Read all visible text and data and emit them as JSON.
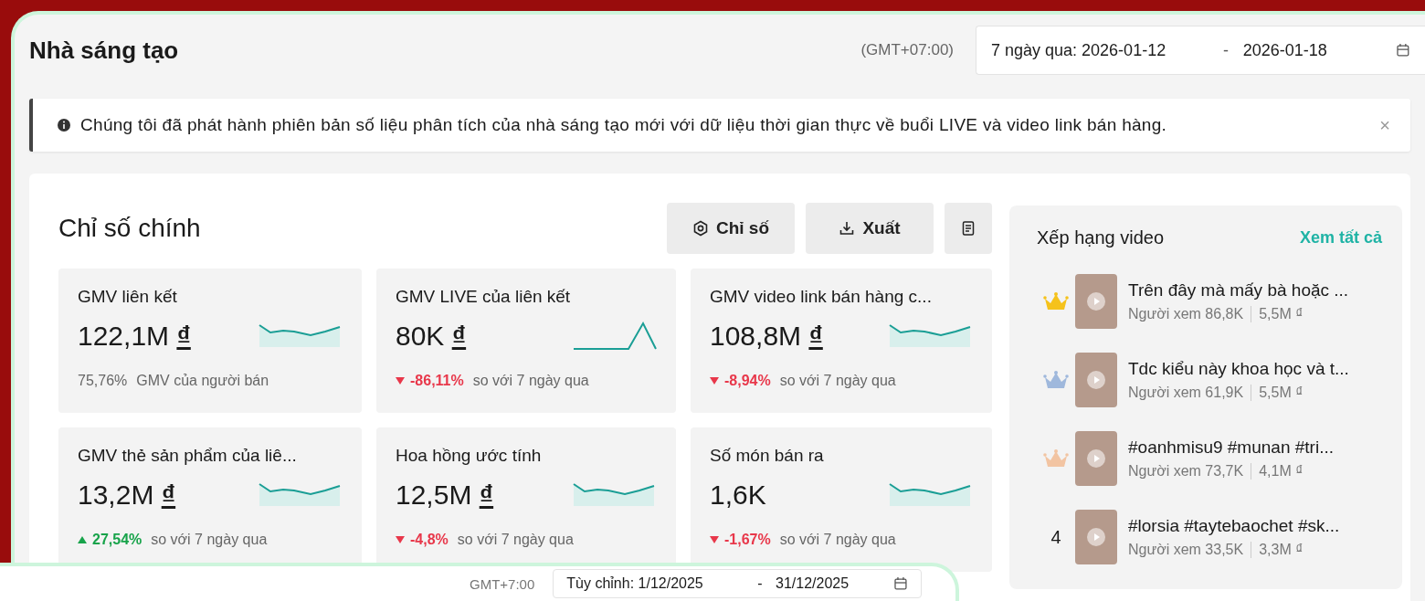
{
  "header": {
    "title": "Nhà sáng tạo",
    "timezone": "(GMT+07:00)",
    "date_range": {
      "start": "7 ngày qua: 2026-01-12",
      "separator": "-",
      "end": "2026-01-18"
    }
  },
  "notice": {
    "text": "Chúng tôi đã phát hành phiên bản số liệu phân tích của nhà sáng tạo mới với dữ liệu thời gian thực về buổi LIVE và video link bán hàng.",
    "close": "×"
  },
  "metrics": {
    "title": "Chỉ số chính",
    "buttons": [
      {
        "label": "Chỉ số",
        "kind": "settings"
      },
      {
        "label": "Xuất",
        "kind": "download"
      },
      {
        "kind": "report"
      }
    ],
    "cards": [
      {
        "kind": "wave",
        "label": "GMV liên kết",
        "value": "122,1M",
        "currency": "₫",
        "up": false,
        "down": false,
        "change": "75,76%",
        "note": "GMV của người bán"
      },
      {
        "kind": "spike",
        "label": "GMV LIVE của liên kết",
        "value": "80K",
        "currency": "₫",
        "up": false,
        "down": true,
        "change": "-86,11%",
        "note": "so với 7 ngày qua"
      },
      {
        "kind": "wave",
        "label": "GMV video link bán hàng c...",
        "value": "108,8M",
        "currency": "₫",
        "up": false,
        "down": true,
        "change": "-8,94%",
        "note": "so với 7 ngày qua"
      },
      {
        "kind": "wave",
        "label": "GMV thẻ sản phẩm của liê...",
        "value": "13,2M",
        "currency": "₫",
        "up": true,
        "down": false,
        "change": "27,54%",
        "note": "so với 7 ngày qua"
      },
      {
        "kind": "wave",
        "label": "Hoa hồng ước tính",
        "value": "12,5M",
        "currency": "₫",
        "up": false,
        "down": true,
        "change": "-4,8%",
        "note": "so với 7 ngày qua"
      },
      {
        "kind": "wave",
        "label": "Số món bán ra",
        "value": "1,6K",
        "up": false,
        "down": true,
        "change": "-1,67%",
        "note": "so với 7 ngày qua"
      }
    ]
  },
  "ranking": {
    "title": "Xếp hạng video",
    "link": "Xem tất cả",
    "items": [
      {
        "kind": "crown",
        "color": "#f5c21b",
        "title": "Trên đây mà mấy bà hoặc ...",
        "viewers": "Người xem 86,8K",
        "gmv": "5,5M ₫"
      },
      {
        "kind": "crown",
        "color": "#9fb8dc",
        "title": "Tdc kiểu này khoa học và t...",
        "viewers": "Người xem 61,9K",
        "gmv": "5,5M ₫"
      },
      {
        "kind": "crown",
        "color": "#f2c4a2",
        "title": "#oanhmisu9 #munan #tri...",
        "viewers": "Người xem 73,7K",
        "gmv": "4,1M ₫"
      },
      {
        "kind": "number",
        "rank": "4",
        "title": "#lorsia #taytebaochet #sk...",
        "viewers": "Người xem 33,5K",
        "gmv": "3,3M ₫"
      }
    ]
  },
  "second_window": {
    "timezone": "GMT+7:00",
    "date_range": {
      "start": "Tùy chỉnh: 1/12/2025",
      "separator": "-",
      "end": "31/12/2025"
    }
  }
}
